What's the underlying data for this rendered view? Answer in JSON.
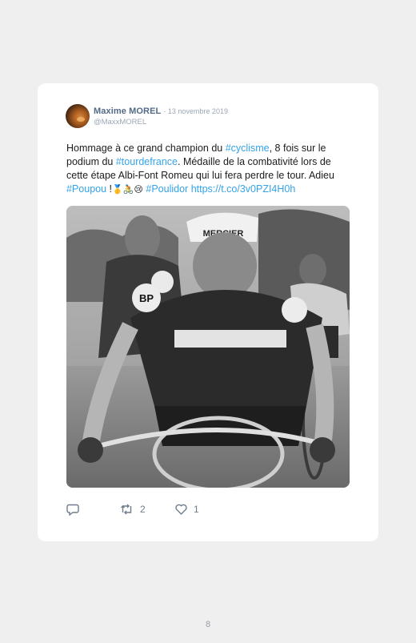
{
  "tweet": {
    "author_name": "Maxime MOREL",
    "date": "· 13 novembre 2019",
    "handle": "@MaxxMOREL",
    "text": {
      "p1": "Hommage à ce grand champion du ",
      "tag_cyclisme": "#cyclisme",
      "p2": ", 8 fois sur le podium du ",
      "tag_tdf": "#tourdefrance",
      "p3": ". Médaille de la combativité lors de cette étape Albi-Font Romeu qui lui fera perdre le tour. Adieu ",
      "tag_poupou": "#Poupou",
      "p4": " !",
      "emojis": "🥇🚴😢",
      "tag_poulidor": "#Poulidor",
      "link": "https://t.co/3v0PZI4H0h"
    },
    "photo_jersey_text": "MERCIER",
    "photo_badge_text": "BP",
    "replies_count": "",
    "retweets_count": "2",
    "likes_count": "1"
  },
  "page_number": "8",
  "colors": {
    "background": "#efefef",
    "card": "#ffffff",
    "name": "#536a87",
    "meta": "#9aa7b6",
    "hashtag": "#35a3ea",
    "icon": "#6f7d8c"
  }
}
